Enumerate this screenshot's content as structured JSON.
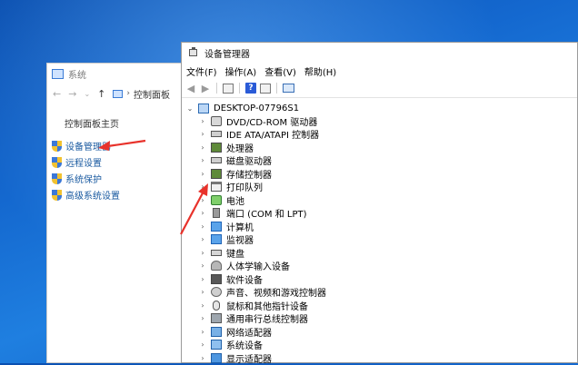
{
  "system_window": {
    "title": "系统",
    "breadcrumb": "控制面板",
    "home_label": "控制面板主页",
    "links": [
      "设备管理器",
      "远程设置",
      "系统保护",
      "高级系统设置"
    ]
  },
  "device_manager": {
    "title": "设备管理器",
    "menu": [
      "文件(F)",
      "操作(A)",
      "查看(V)",
      "帮助(H)"
    ],
    "root": "DESKTOP-07796S1",
    "categories": [
      "DVD/CD-ROM 驱动器",
      "IDE ATA/ATAPI 控制器",
      "处理器",
      "磁盘驱动器",
      "存储控制器",
      "打印队列",
      "电池",
      "端口 (COM 和 LPT)",
      "计算机",
      "监视器",
      "键盘",
      "人体学输入设备",
      "软件设备",
      "声音、视频和游戏控制器",
      "鼠标和其他指针设备",
      "通用串行总线控制器",
      "网络适配器",
      "系统设备",
      "显示适配器"
    ]
  },
  "annotation_color": "#e8322b"
}
